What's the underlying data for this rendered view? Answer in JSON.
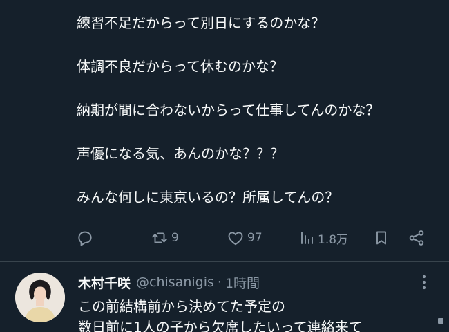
{
  "tweet": {
    "lines": [
      "練習不足だからって別日にするのかな？",
      "体調不良だからって休むのかな？",
      "納期が間に合わないからって仕事してんのかな？",
      "声優になる気、あんのかな？？？",
      "みんな何しに東京いるの？所属してんの？"
    ],
    "actions": {
      "reply_icon": "reply-bubble-icon",
      "retweet_icon": "retweet-icon",
      "retweet_count": "9",
      "like_icon": "heart-icon",
      "like_count": "97",
      "views_icon": "bar-chart-icon",
      "views_count": "1.8万",
      "bookmark_icon": "bookmark-icon",
      "share_icon": "share-icon"
    }
  },
  "reply": {
    "author_name": "木村千咲",
    "author_handle": "@chisanigis",
    "separator": "·",
    "time": "1時間",
    "more_icon": "more-vertical-icon",
    "text_lines": [
      "この前結構前から決めてた予定の",
      "数日前に1人の子から欠席したいって連絡来て"
    ]
  },
  "colors": {
    "background": "#15202b",
    "text": "#f7f9f9",
    "muted": "#8b98a5",
    "divider": "#38444d"
  }
}
